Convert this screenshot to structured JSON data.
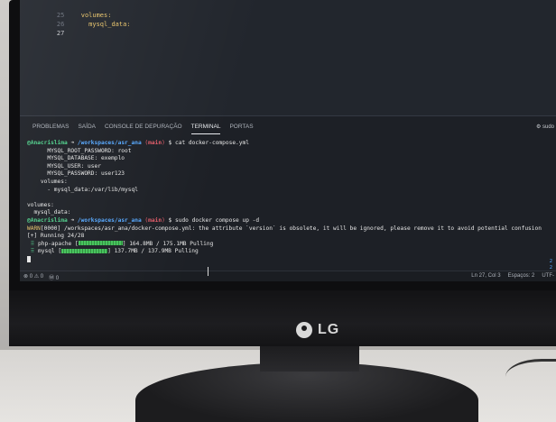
{
  "editor": {
    "lines": [
      {
        "num": "25",
        "text": "volumes:",
        "indent": "  "
      },
      {
        "num": "26",
        "text": "mysql_data:",
        "indent": "    "
      },
      {
        "num": "27",
        "text": "",
        "indent": ""
      }
    ]
  },
  "panel": {
    "tabs": [
      "PROBLEMAS",
      "SAÍDA",
      "CONSOLE DE DEPURAÇÃO",
      "TERMINAL",
      "PORTAS"
    ],
    "active_tab": "TERMINAL",
    "right_label": "sudo"
  },
  "terminal": {
    "prompt1": {
      "user": "@Anacrislima",
      "arrow": "➜",
      "path": "/workspaces/asr_ana",
      "branch": "main",
      "command": "cat docker-compose.yml"
    },
    "output": [
      "      MYSQL_ROOT_PASSWORD: root",
      "      MYSQL_DATABASE: exemplo",
      "      MYSQL_USER: user",
      "      MYSQL_PASSWORD: user123",
      "    volumes:",
      "      - mysql_data:/var/lib/mysql",
      "",
      "volumes:",
      "  mysql_data:"
    ],
    "prompt2": {
      "user": "@Anacrislima",
      "arrow": "➜",
      "path": "/workspaces/asr_ana",
      "branch": "main",
      "command": "sudo docker compose up -d"
    },
    "warn_tag": "WARN",
    "warn_text": "[0000] /workspaces/asr_ana/docker-compose.yml: the attribute `version` is obsolete, it will be ignored, please remove it to avoid potential confusion",
    "running": "[+] Running 24/28",
    "pulls": [
      {
        "name": "php-apache",
        "progress": "164.8MB / 175.1MB",
        "status": "Pulling",
        "fraction": 0.94
      },
      {
        "name": "mysql",
        "progress": "137.7MB / 137.9MB",
        "status": "Pulling",
        "fraction": 0.99
      }
    ],
    "right_nums": [
      "2",
      "2"
    ]
  },
  "statusbar": {
    "left": [
      "⊗ 0 ⚠ 0",
      "Ⓦ 0"
    ],
    "right": [
      "Ln 27, Col 3",
      "Espaços: 2",
      "UTF-"
    ]
  },
  "monitor": {
    "brand": "LG"
  }
}
